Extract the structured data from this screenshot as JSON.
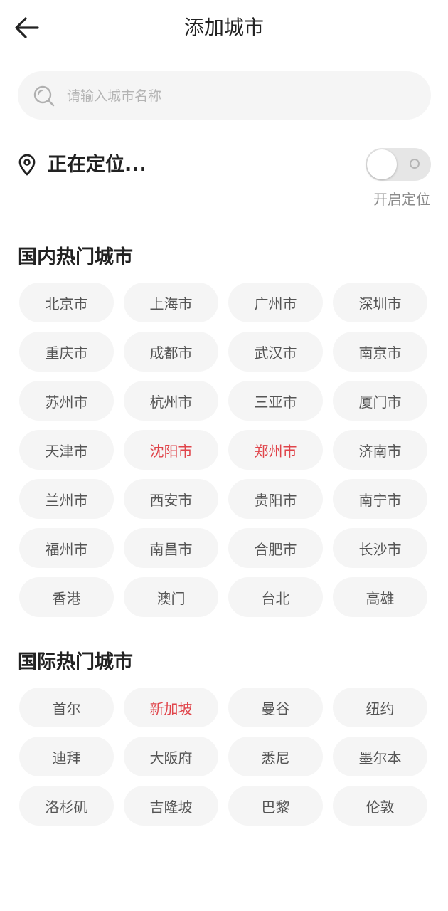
{
  "header": {
    "title": "添加城市",
    "back_icon": "arrow-left-icon"
  },
  "search": {
    "placeholder": "请输入城市名称",
    "value": "",
    "icon": "search-icon"
  },
  "location": {
    "status": "正在定位...",
    "toggle_label": "开启定位",
    "toggle_on": false,
    "icon": "location-pin-icon"
  },
  "colors": {
    "highlight": "#e0444a",
    "chip_bg": "#f5f5f5",
    "text": "#222222",
    "muted": "#8a8a8a"
  },
  "domestic": {
    "title": "国内热门城市",
    "cities": [
      {
        "name": "北京市",
        "highlight": false
      },
      {
        "name": "上海市",
        "highlight": false
      },
      {
        "name": "广州市",
        "highlight": false
      },
      {
        "name": "深圳市",
        "highlight": false
      },
      {
        "name": "重庆市",
        "highlight": false
      },
      {
        "name": "成都市",
        "highlight": false
      },
      {
        "name": "武汉市",
        "highlight": false
      },
      {
        "name": "南京市",
        "highlight": false
      },
      {
        "name": "苏州市",
        "highlight": false
      },
      {
        "name": "杭州市",
        "highlight": false
      },
      {
        "name": "三亚市",
        "highlight": false
      },
      {
        "name": "厦门市",
        "highlight": false
      },
      {
        "name": "天津市",
        "highlight": false
      },
      {
        "name": "沈阳市",
        "highlight": true
      },
      {
        "name": "郑州市",
        "highlight": true
      },
      {
        "name": "济南市",
        "highlight": false
      },
      {
        "name": "兰州市",
        "highlight": false
      },
      {
        "name": "西安市",
        "highlight": false
      },
      {
        "name": "贵阳市",
        "highlight": false
      },
      {
        "name": "南宁市",
        "highlight": false
      },
      {
        "name": "福州市",
        "highlight": false
      },
      {
        "name": "南昌市",
        "highlight": false
      },
      {
        "name": "合肥市",
        "highlight": false
      },
      {
        "name": "长沙市",
        "highlight": false
      },
      {
        "name": "香港",
        "highlight": false
      },
      {
        "name": "澳门",
        "highlight": false
      },
      {
        "name": "台北",
        "highlight": false
      },
      {
        "name": "高雄",
        "highlight": false
      }
    ]
  },
  "international": {
    "title": "国际热门城市",
    "cities": [
      {
        "name": "首尔",
        "highlight": false
      },
      {
        "name": "新加坡",
        "highlight": true
      },
      {
        "name": "曼谷",
        "highlight": false
      },
      {
        "name": "纽约",
        "highlight": false
      },
      {
        "name": "迪拜",
        "highlight": false
      },
      {
        "name": "大阪府",
        "highlight": false
      },
      {
        "name": "悉尼",
        "highlight": false
      },
      {
        "name": "墨尔本",
        "highlight": false
      },
      {
        "name": "洛杉矶",
        "highlight": false
      },
      {
        "name": "吉隆坡",
        "highlight": false
      },
      {
        "name": "巴黎",
        "highlight": false
      },
      {
        "name": "伦敦",
        "highlight": false
      }
    ]
  }
}
